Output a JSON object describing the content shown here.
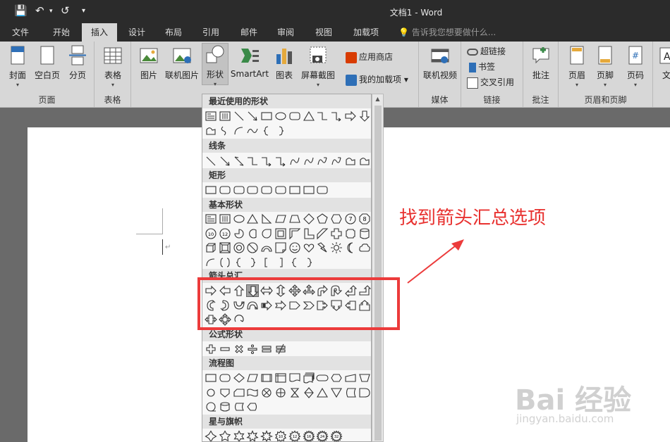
{
  "titlebar": {
    "title": "文档1 - Word",
    "dropdown": "▾"
  },
  "tabs": [
    "文件",
    "开始",
    "插入",
    "设计",
    "布局",
    "引用",
    "邮件",
    "审阅",
    "视图",
    "加载项"
  ],
  "tellme": "告诉我您想要做什么...",
  "ribbon": {
    "pages": {
      "label": "页面",
      "cover": "封面",
      "blank": "空白页",
      "break": "分页"
    },
    "tables": {
      "label": "表格",
      "table": "表格"
    },
    "illus": {
      "picture": "图片",
      "online_picture": "联机图片",
      "shapes": "形状",
      "smartart": "SmartArt",
      "chart": "图表",
      "screenshot": "屏幕截图"
    },
    "addins": {
      "store": "应用商店",
      "my_addins": "我的加载项"
    },
    "media": {
      "label": "媒体",
      "video": "联机视频"
    },
    "links": {
      "label": "链接",
      "hyperlink": "超链接",
      "bookmark": "书签",
      "crossref": "交叉引用"
    },
    "comments": {
      "label": "批注",
      "comment": "批注"
    },
    "headerfooter": {
      "label": "页眉和页脚",
      "header": "页眉",
      "footer": "页脚",
      "pagenum": "页码"
    },
    "text": {
      "label": "文"
    }
  },
  "gallery": {
    "sections": [
      "最近使用的形状",
      "线条",
      "矩形",
      "基本形状",
      "箭头总汇",
      "公式形状",
      "流程图",
      "星与旗帜"
    ]
  },
  "annotation": "找到箭头汇总选项",
  "watermark": {
    "main": "Bai 经验",
    "sub": "jingyan.baidu.com"
  },
  "colors": {
    "accent": "#ec3b3b",
    "ribbon": "#d7d7d7",
    "titlebar": "#2b2b2b"
  }
}
